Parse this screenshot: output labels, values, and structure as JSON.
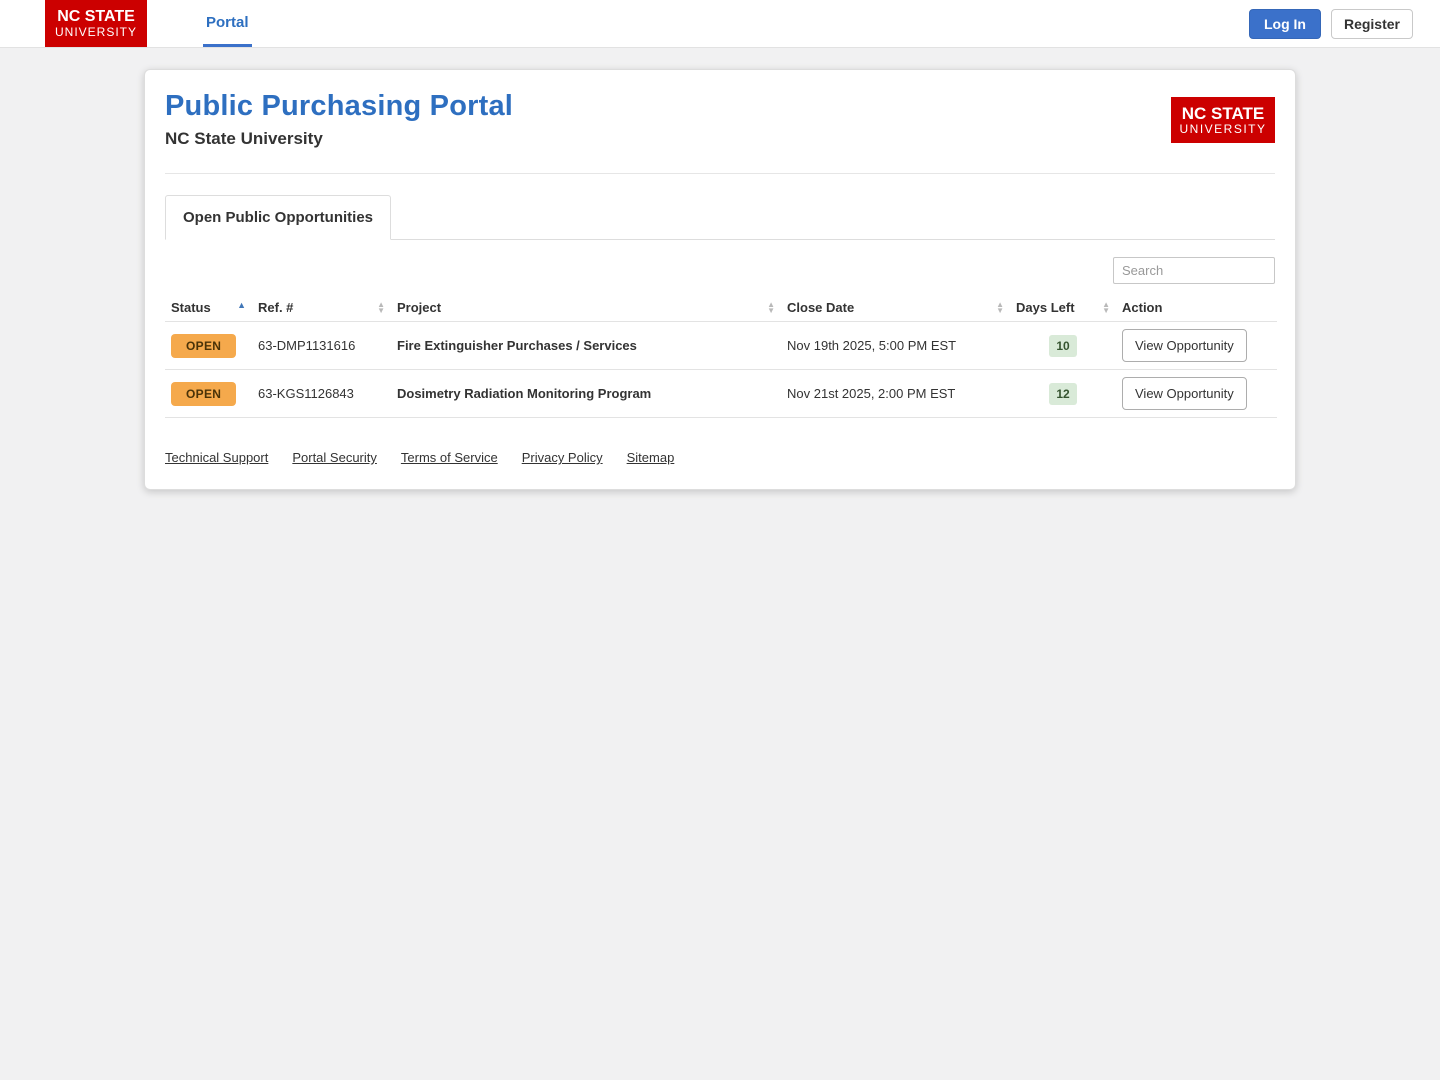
{
  "topnav": {
    "logo": {
      "line1": "NC STATE",
      "line2": "UNIVERSITY"
    },
    "portal_link": "Portal",
    "login_button": "Log In",
    "register_button": "Register"
  },
  "card": {
    "title": "Public Purchasing Portal",
    "subtitle": "NC State University",
    "logo": {
      "line1": "NC STATE",
      "line2": "UNIVERSITY"
    },
    "tab_label": "Open Public Opportunities",
    "search_placeholder": "Search",
    "table": {
      "headers": [
        "Status",
        "Ref. #",
        "Project",
        "Close Date",
        "Days Left",
        "Action"
      ],
      "rows": [
        {
          "status": "OPEN",
          "ref": "63-DMP1131616",
          "project": "Fire Extinguisher Purchases / Services",
          "close_date": "Nov 19th 2025, 5:00 PM EST",
          "days_left": "10",
          "action": "View Opportunity"
        },
        {
          "status": "OPEN",
          "ref": "63-KGS1126843",
          "project": "Dosimetry Radiation Monitoring Program",
          "close_date": "Nov 21st 2025, 2:00 PM EST",
          "days_left": "12",
          "action": "View Opportunity"
        }
      ]
    },
    "footer_links": [
      "Technical Support",
      "Portal Security",
      "Terms of Service",
      "Privacy Policy",
      "Sitemap"
    ]
  },
  "icons": {
    "sort_asc": "▲",
    "sort_desc": "▼"
  },
  "colors": {
    "brand_red": "#cc0000",
    "link_blue": "#2e6fc0",
    "login_button_blue": "#3b71ca",
    "open_badge_orange": "#f5a94c",
    "days_badge_green": "#d9ead8"
  }
}
